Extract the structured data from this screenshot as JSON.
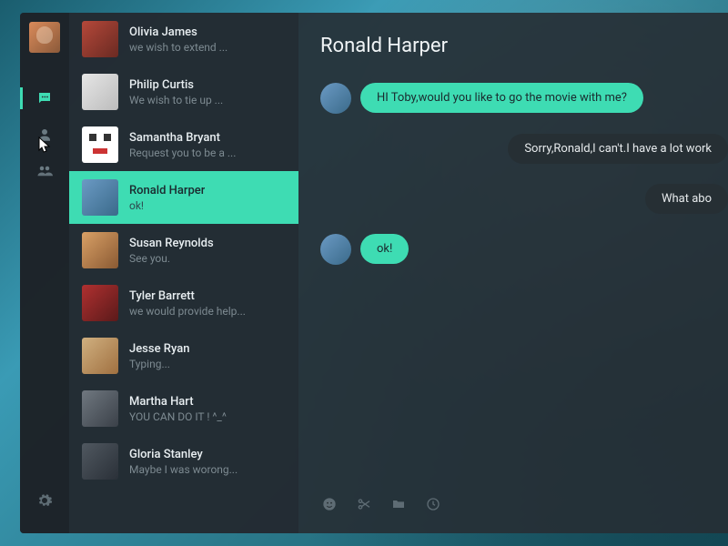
{
  "accent_color": "#3edcb3",
  "rail": {
    "icons": [
      "messages",
      "contact",
      "groups",
      "settings"
    ]
  },
  "contacts": [
    {
      "name": "Olivia James",
      "preview": "we wish to extend ...",
      "active": false,
      "av": "av1"
    },
    {
      "name": "Philip Curtis",
      "preview": "We wish to tie up ...",
      "active": false,
      "av": "av2"
    },
    {
      "name": "Samantha Bryant",
      "preview": "Request you to be a ...",
      "active": false,
      "av": "av3"
    },
    {
      "name": "Ronald Harper",
      "preview": "ok!",
      "active": true,
      "av": "av4"
    },
    {
      "name": "Susan Reynolds",
      "preview": "See you.",
      "active": false,
      "av": "av5"
    },
    {
      "name": "Tyler Barrett",
      "preview": "we would provide help...",
      "active": false,
      "av": "av6"
    },
    {
      "name": "Jesse Ryan",
      "preview": "Typing...",
      "active": false,
      "av": "av7"
    },
    {
      "name": "Martha Hart",
      "preview": "YOU CAN DO IT ! ^_^",
      "active": false,
      "av": "av8"
    },
    {
      "name": "Gloria Stanley",
      "preview": "Maybe I was worong...",
      "active": false,
      "av": "av9"
    }
  ],
  "chat": {
    "title": "Ronald Harper",
    "messages": [
      {
        "side": "them",
        "text": "HI Toby,would you like to go the movie with me?"
      },
      {
        "side": "me",
        "text": "Sorry,Ronald,I can't.I have a lot work"
      },
      {
        "side": "me",
        "text": "What abo"
      },
      {
        "side": "them",
        "text": "ok!"
      }
    ],
    "input_icons": [
      "emoji",
      "scissors",
      "folder",
      "clock"
    ]
  }
}
